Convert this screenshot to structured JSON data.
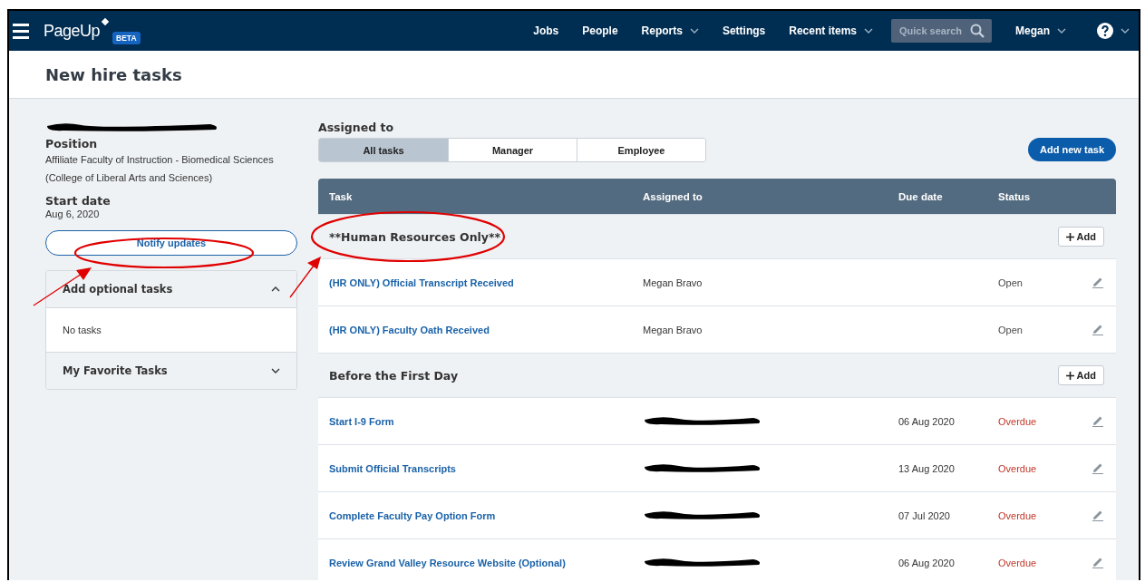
{
  "navbar": {
    "brand": "PageUp",
    "badge": "BETA",
    "links": [
      {
        "label": "Jobs",
        "dropdown": false
      },
      {
        "label": "People",
        "dropdown": false
      },
      {
        "label": "Reports",
        "dropdown": true
      },
      {
        "label": "Settings",
        "dropdown": false
      },
      {
        "label": "Recent items",
        "dropdown": true
      }
    ],
    "search": {
      "placeholder": "Quick search"
    },
    "user": "Megan"
  },
  "page_title": "New hire tasks",
  "sidebar": {
    "position_label": "Position",
    "position": "Affiliate Faculty of Instruction - Biomedical Sciences (College of Liberal Arts and Sciences)",
    "start_label": "Start date",
    "start_date": "Aug 6, 2020",
    "notify_button": "Notify updates",
    "panels": [
      {
        "title": "Add optional tasks",
        "expanded": true,
        "body": "No tasks"
      },
      {
        "title": "My Favorite Tasks",
        "expanded": false
      }
    ]
  },
  "assigned_label": "Assigned to",
  "tabs": [
    {
      "label": "All tasks",
      "selected": true
    },
    {
      "label": "Manager",
      "selected": false
    },
    {
      "label": "Employee",
      "selected": false
    }
  ],
  "add_task_button": "Add new task",
  "table": {
    "columns": [
      "Task",
      "Assigned to",
      "Due date",
      "Status"
    ],
    "groups": [
      {
        "title": "**Human Resources Only**",
        "add_label": "Add",
        "rows": [
          {
            "task": "(HR ONLY) Official Transcript Received",
            "assigned_to": "Megan Bravo",
            "status": "Open",
            "color": "#4a4a4a"
          },
          {
            "task": "(HR ONLY) Faculty Oath Received",
            "assigned_to": "Megan Bravo",
            "status": "Open",
            "color": "#4a4a4a"
          }
        ]
      },
      {
        "title": "Before the First Day",
        "add_label": "Add",
        "rows": [
          {
            "task": "Start I-9 Form",
            "due": "06 Aug 2020",
            "status": "Overdue",
            "color": "#c0392b"
          },
          {
            "task": "Submit Official Transcripts",
            "due": "13 Aug 2020",
            "status": "Overdue",
            "color": "#c0392b"
          },
          {
            "task": "Complete Faculty Pay Option Form",
            "due": "07 Jul 2020",
            "status": "Overdue",
            "color": "#c0392b"
          },
          {
            "task": "Review Grand Valley Resource Website (Optional)",
            "due": "06 Aug 2020",
            "status": "Overdue",
            "color": "#c0392b"
          }
        ]
      }
    ]
  }
}
